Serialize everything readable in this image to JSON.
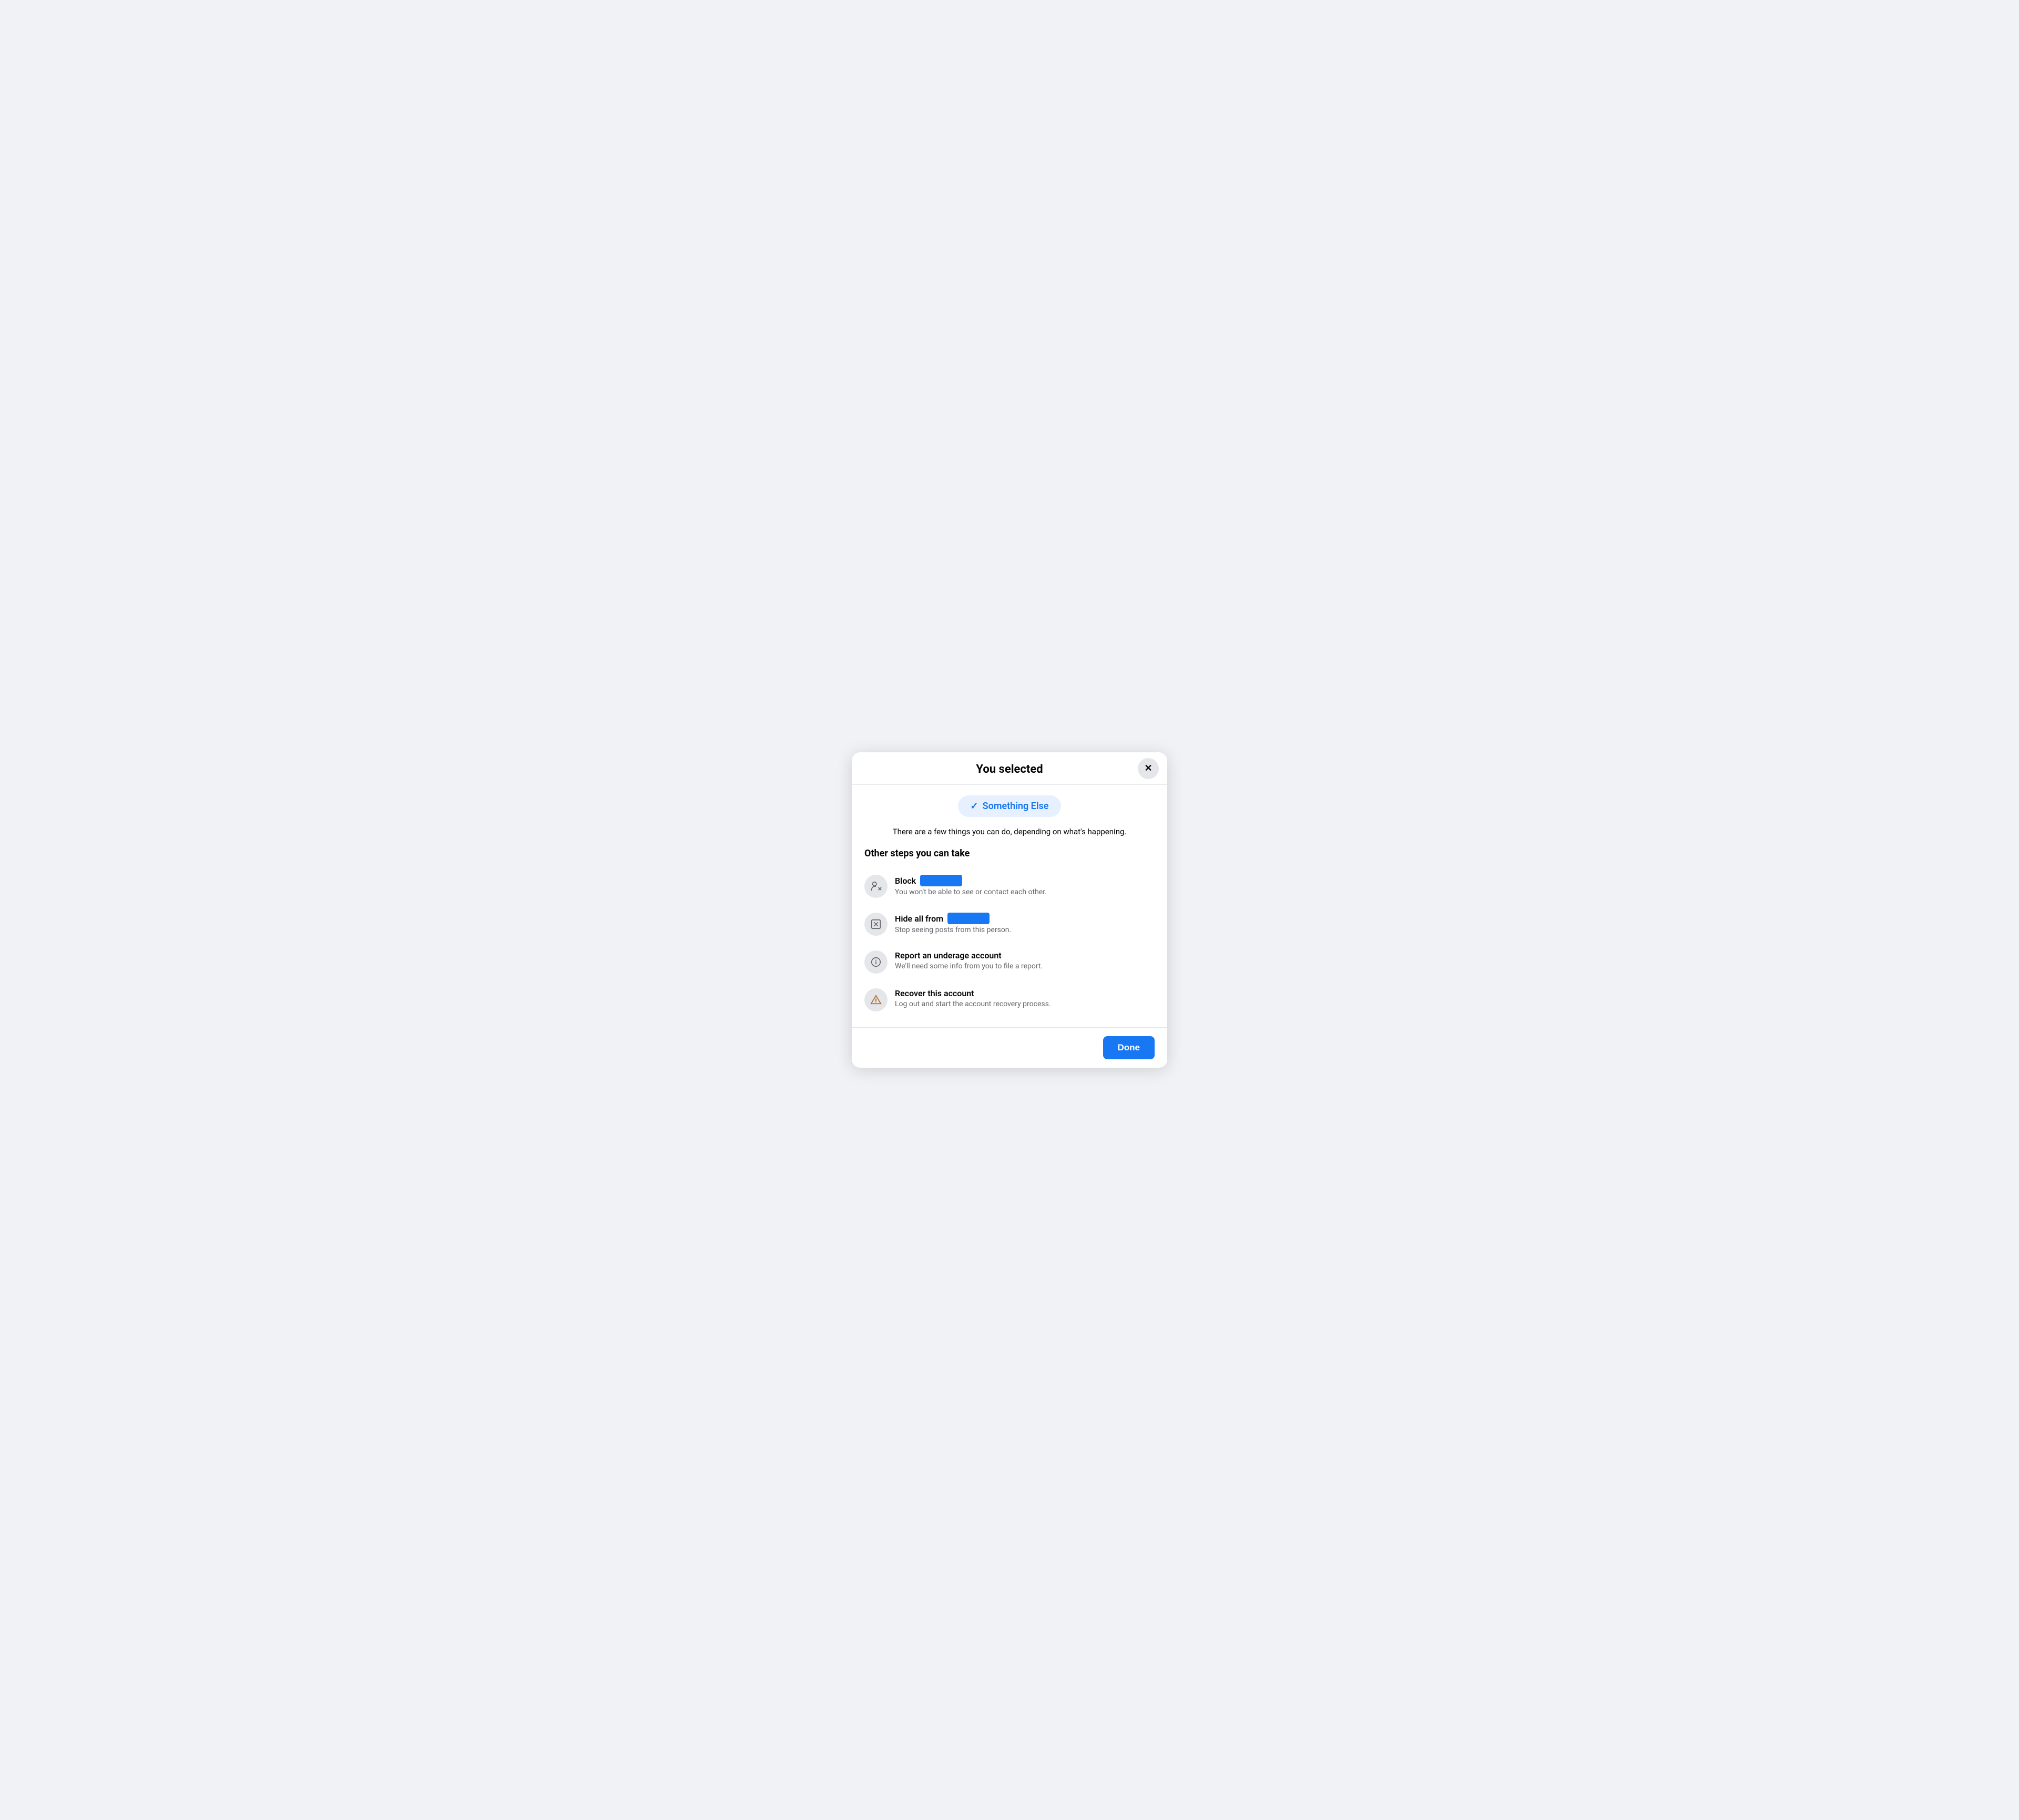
{
  "modal": {
    "title": "You selected",
    "close_label": "✕",
    "selection_badge": {
      "checkmark": "✓",
      "label": "Something Else"
    },
    "description": "There are a few things you can do, depending on what's happening.",
    "section_title": "Other steps you can take",
    "actions": [
      {
        "id": "block",
        "title_prefix": "Block",
        "has_redacted": true,
        "redacted_size": "small",
        "description": "You won't be able to see or contact each other.",
        "icon_type": "block-person"
      },
      {
        "id": "hide",
        "title_prefix": "Hide all from",
        "has_redacted": true,
        "redacted_size": "medium",
        "description": "Stop seeing posts from this person.",
        "icon_type": "hide-box"
      },
      {
        "id": "report-underage",
        "title_prefix": "Report an underage account",
        "has_redacted": false,
        "description": "We'll need some info from you to file a report.",
        "icon_type": "info"
      },
      {
        "id": "recover",
        "title_prefix": "Recover this account",
        "has_redacted": false,
        "description": "Log out and start the account recovery process.",
        "icon_type": "warning"
      }
    ],
    "footer": {
      "done_label": "Done"
    }
  }
}
